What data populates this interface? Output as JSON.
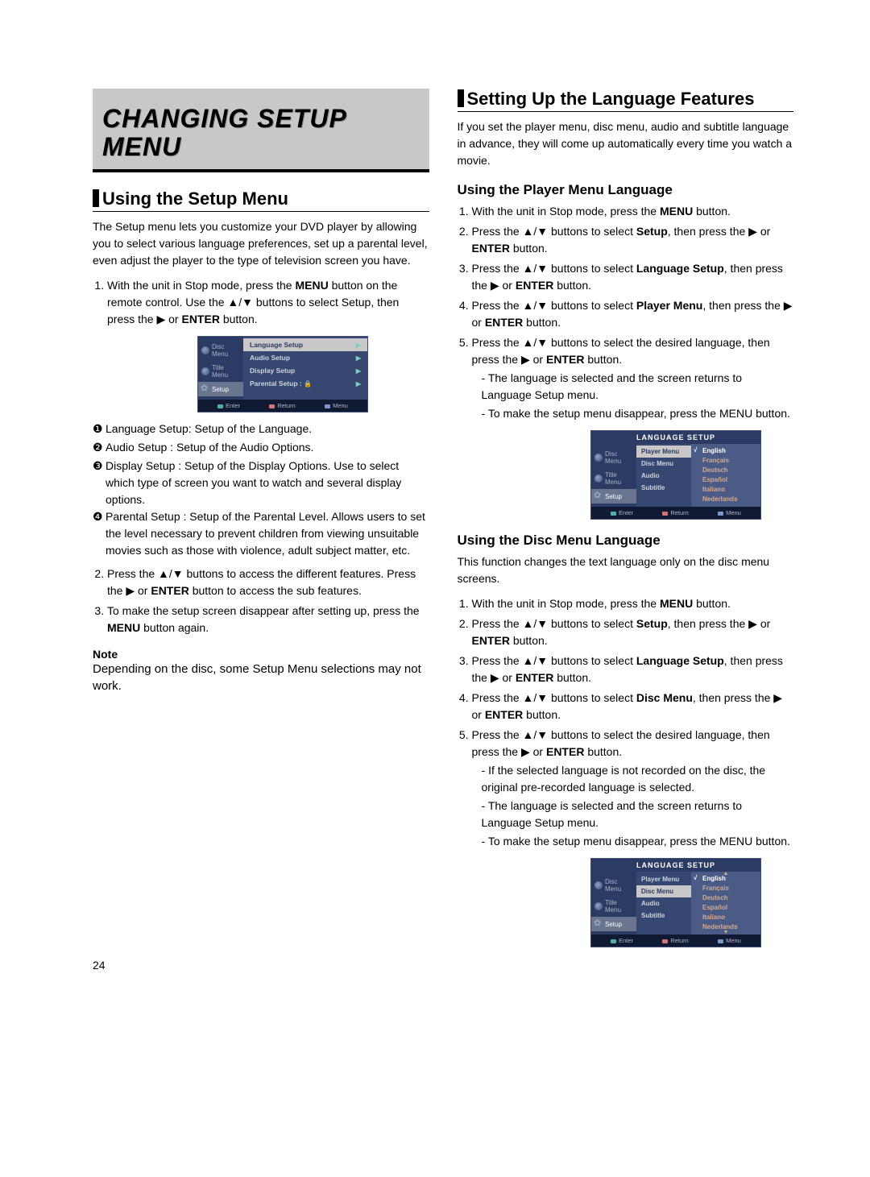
{
  "chapter_title": "CHANGING SETUP MENU",
  "left": {
    "h2": "Using the Setup Menu",
    "intro": "The Setup menu lets you customize your DVD player by allowing you to select various language preferences, set up a parental level, even adjust the player to the type of television screen you have.",
    "step1_a": "With the unit in Stop mode, press the ",
    "step1_b": " button on the remote control.  Use the ▲/▼ buttons to select Setup, then press the ▶ or ",
    "step1_c": " button.",
    "menu_btn": "MENU",
    "enter_btn": "ENTER",
    "osd1": {
      "side": [
        "Disc Menu",
        "Title Menu",
        "Setup"
      ],
      "rows": [
        {
          "t": "Language Setup",
          "a": "▶",
          "hl": true
        },
        {
          "t": "Audio Setup",
          "a": "▶"
        },
        {
          "t": "Display Setup",
          "a": "▶"
        },
        {
          "t": "Parental Setup :",
          "a": "▶",
          "lock": "🔒"
        }
      ],
      "foot": [
        "Enter",
        "Return",
        "Menu"
      ]
    },
    "defs": [
      {
        "n": "❶",
        "label": "Language Setup:",
        "desc": " Setup of the Language."
      },
      {
        "n": "❷",
        "label": "Audio Setup :",
        "desc": " Setup of the Audio Options."
      },
      {
        "n": "❸",
        "label": "Display Setup :",
        "desc": " Setup of the Display Options. Use to select which type of screen you want to watch and several display options."
      },
      {
        "n": "❹",
        "label": "Parental Setup :",
        "desc": " Setup of the Parental Level. Allows users to set the level necessary to prevent children from viewing unsuitable movies such as those with violence, adult subject matter, etc."
      }
    ],
    "step2_a": "Press the ▲/▼ buttons to access the different  features. Press the ▶ or ",
    "step2_b": " button to access the sub features.",
    "step3_a": "To make the setup screen disappear after setting up, press the ",
    "step3_b": " button again.",
    "note_h": "Note",
    "note_t": "Depending on the disc, some Setup Menu selections may not work."
  },
  "right": {
    "h2": "Setting Up the Language Features",
    "intro": "If you set the player menu, disc menu, audio and subtitle language in advance, they will come up automatically every time you watch a movie.",
    "h3_player": "Using the Player Menu Language",
    "player_steps": {
      "s1_a": "With the unit in Stop mode, press the ",
      "s1_b": " button.",
      "s2_a": "Press the ▲/▼ buttons to select ",
      "s2_bold": "Setup",
      "s2_b": ", then press the ▶ or ",
      "s2_c": " button.",
      "s3_a": "Press the ▲/▼ buttons to select ",
      "s3_bold": "Language Setup",
      "s3_b": ", then press the ▶ or ",
      "s3_c": " button.",
      "s4_a": "Press the ▲/▼ buttons to select ",
      "s4_bold": "Player Menu",
      "s4_b": ", then press the ▶ or ",
      "s4_c": " button.",
      "s5_a": "Press the ▲/▼ buttons to select the desired language, then press the ▶ or ",
      "s5_b": " button.",
      "s5_d1": "The language is selected and the screen returns to Language Setup menu.",
      "s5_d2": "To make the setup menu disappear, press the MENU button."
    },
    "osd_lang": {
      "header": "LANGUAGE SETUP",
      "side": [
        "Disc Menu",
        "Title Menu",
        "Setup"
      ],
      "col1": [
        "Player Menu",
        "Disc Menu",
        "Audio",
        "Subtitle"
      ],
      "col2": [
        "English",
        "Français",
        "Deutsch",
        "Español",
        "Italiano",
        "Nederlands"
      ],
      "foot": [
        "Enter",
        "Return",
        "Menu"
      ]
    },
    "h3_disc": "Using the Disc Menu Language",
    "disc_intro": "This function changes the text language only on the disc menu screens.",
    "disc_steps": {
      "s1_a": "With the unit in Stop mode, press the ",
      "s1_b": " button.",
      "s2_a": "Press the ▲/▼ buttons to select ",
      "s2_bold": "Setup",
      "s2_b": ", then press the ▶ or ",
      "s2_c": " button.",
      "s3_a": "Press the ▲/▼ buttons to select ",
      "s3_bold": "Language Setup",
      "s3_b": ", then press the ▶ or ",
      "s3_c": " button.",
      "s4_a": "Press the ▲/▼ buttons to select ",
      "s4_bold": "Disc Menu",
      "s4_b": ", then press the ▶ or ",
      "s4_c": "  button.",
      "s5_a": "Press the ▲/▼ buttons to select the desired      language, then press the ▶ or ",
      "s5_b": " button.",
      "s5_d1": "If the selected language is not recorded on  the disc, the original pre-recorded language is selected.",
      "s5_d2": "The language is selected and the screen returns to Language Setup menu.",
      "s5_d3": "To make the setup menu disappear, press the MENU button."
    }
  },
  "page_number": "24"
}
